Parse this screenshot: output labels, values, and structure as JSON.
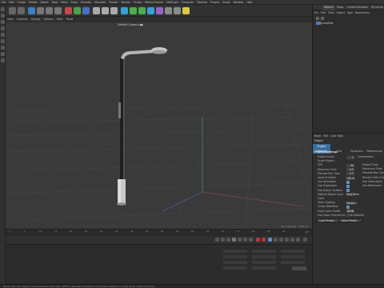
{
  "menubar": [
    "File",
    "Edit",
    "Create",
    "Modes",
    "Select",
    "Tools",
    "Mesh",
    "Snap",
    "Animate",
    "Simulate",
    "Tracker",
    "Render",
    "Sculpt",
    "Motion Tracker",
    "MoGraph",
    "Character",
    "Pipeline",
    "Plugins",
    "Script",
    "Window",
    "Help"
  ],
  "viewport": {
    "menu": [
      "View",
      "Cameras",
      "Display",
      "Options",
      "Filter",
      "Panel"
    ],
    "camera_label": "Default Camera ●▸",
    "status": "Grid Spacing : 1000 cm"
  },
  "timeline": {
    "frames": [
      "0",
      "5",
      "10",
      "15",
      "20",
      "25",
      "30",
      "35",
      "40",
      "45",
      "50",
      "55",
      "60",
      "65",
      "70",
      "75",
      "80",
      "85",
      "90"
    ],
    "current": "0 F"
  },
  "object_manager": {
    "tabs": [
      "Objects",
      "Takes",
      "Content Browser",
      "Structure"
    ],
    "menu": [
      "File",
      "Edit",
      "View",
      "Object",
      "Tags",
      "Bookmarks"
    ],
    "object_name": "LAMP_POST",
    "object_name_shown": "LampPost"
  },
  "attributes": {
    "menu": [
      "Mode",
      "Edit",
      "User Data"
    ],
    "title": "Project",
    "tabs": [
      "Project Settings",
      "Info",
      "Dynamics",
      "Referencing"
    ],
    "section": "Project Settings",
    "rows_left": [
      {
        "label": "Project Scale",
        "value": "1",
        "unit": "Centimeters"
      },
      {
        "label": "Scale Project...",
        "value": ""
      },
      {
        "label": "FPS",
        "value": "30"
      },
      {
        "label": "Minimum Time",
        "value": "0 F"
      },
      {
        "label": "Preview Min Time",
        "value": "0 F"
      },
      {
        "label": "Level of Detail",
        "value": "100 %"
      },
      {
        "label": "Use Animation",
        "check": true
      },
      {
        "label": "Use Expression",
        "check": true
      },
      {
        "label": "Use Motion System",
        "check": true
      },
      {
        "label": "Default Object Color",
        "value": "Gray Blue"
      },
      {
        "label": "Color",
        "value": ""
      },
      {
        "label": "View Clipping",
        "value": "Medium"
      },
      {
        "label": "Linear Workflow",
        "check": true
      },
      {
        "label": "Input Color Profile",
        "value": "sRGB"
      },
      {
        "label": "Use Color Channel for Node Material",
        "check": false
      }
    ],
    "rows_right": [
      "Project Time",
      "Maximum Time",
      "Preview Max Time",
      "Render LOD in Editor",
      "Use Generators",
      "Use Deformers"
    ],
    "buttons": [
      "Load Preset...",
      "Save Preset..."
    ]
  },
  "statusbar": "Move: Click and drag to move elements. Hold down SHIFT to quantize movement / add to the selection in point mode, CTRL to remove."
}
